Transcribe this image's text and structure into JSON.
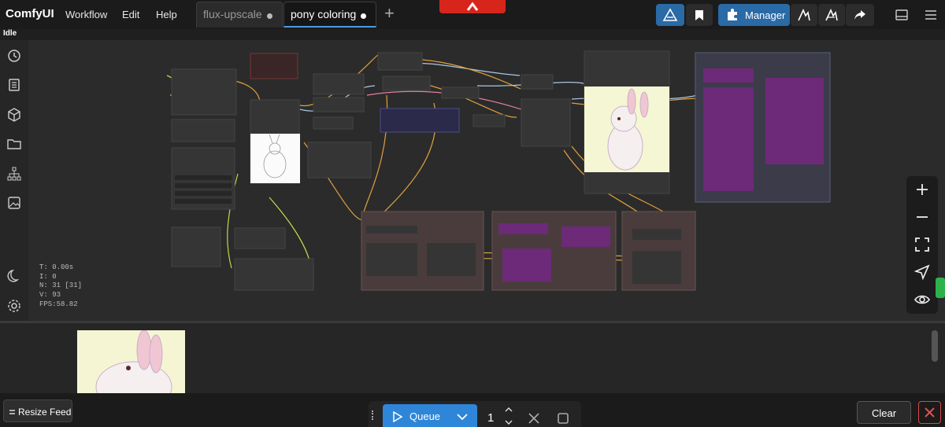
{
  "app": {
    "name": "ComfyUI"
  },
  "menu": [
    "Workflow",
    "Edit",
    "Help"
  ],
  "tabs": [
    {
      "label": "flux-upscale",
      "active": false
    },
    {
      "label": "pony coloring",
      "active": true
    }
  ],
  "toolbar": {
    "manager_label": "Manager"
  },
  "status": {
    "text": "Idle"
  },
  "canvas_stats": {
    "t": "T: 0.00s",
    "i": "I: 0",
    "n": "N: 31 [31]",
    "v": "V: 93",
    "fps": "FPS:58.82"
  },
  "feed": {
    "resize_label": "Resize Feed"
  },
  "queue": {
    "label": "Queue",
    "count": "1"
  },
  "actions": {
    "clear_label": "Clear"
  },
  "colors": {
    "accent": "#2f86d8",
    "danger": "#d84848",
    "group_purple": "#6d2a78",
    "node": "#353535"
  }
}
